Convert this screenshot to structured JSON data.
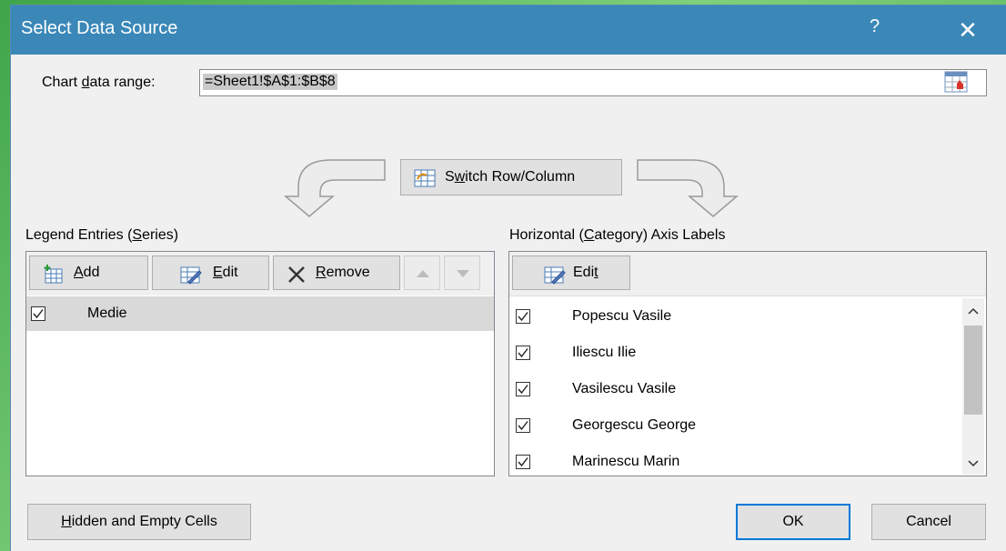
{
  "dialog": {
    "title": "Select Data Source",
    "help_label": "?",
    "close_label": "✕"
  },
  "range": {
    "label_pre": "Chart ",
    "label_accel": "d",
    "label_post": "ata range:",
    "value": "=Sheet1!$A$1:$B$8"
  },
  "switch": {
    "label_pre": "S",
    "label_accel": "w",
    "label_post": "itch Row/Column"
  },
  "legend": {
    "label_pre": "Legend Entries (",
    "label_accel": "S",
    "label_post": "eries)",
    "add_accel": "A",
    "add_rest": "dd",
    "edit_accel": "E",
    "edit_rest": "dit",
    "remove_accel": "R",
    "remove_rest": "emove",
    "series": [
      {
        "name": "Medie",
        "checked": true
      }
    ]
  },
  "axis": {
    "label_pre": "Horizontal (",
    "label_accel": "C",
    "label_post": "ategory) Axis Labels",
    "edit_pre": "Edi",
    "edit_accel": "t",
    "items": [
      {
        "name": "Popescu Vasile",
        "checked": true
      },
      {
        "name": "Iliescu Ilie",
        "checked": true
      },
      {
        "name": "Vasilescu Vasile",
        "checked": true
      },
      {
        "name": "Georgescu George",
        "checked": true
      },
      {
        "name": "Marinescu Marin",
        "checked": true
      }
    ]
  },
  "footer": {
    "hidden_accel": "H",
    "hidden_rest": "idden and Empty Cells",
    "ok_label": "OK",
    "cancel_label": "Cancel"
  },
  "colors": {
    "titlebar": "#3a87b8",
    "selected_row": "#d9d9d9",
    "primary_border": "#0078d7"
  }
}
